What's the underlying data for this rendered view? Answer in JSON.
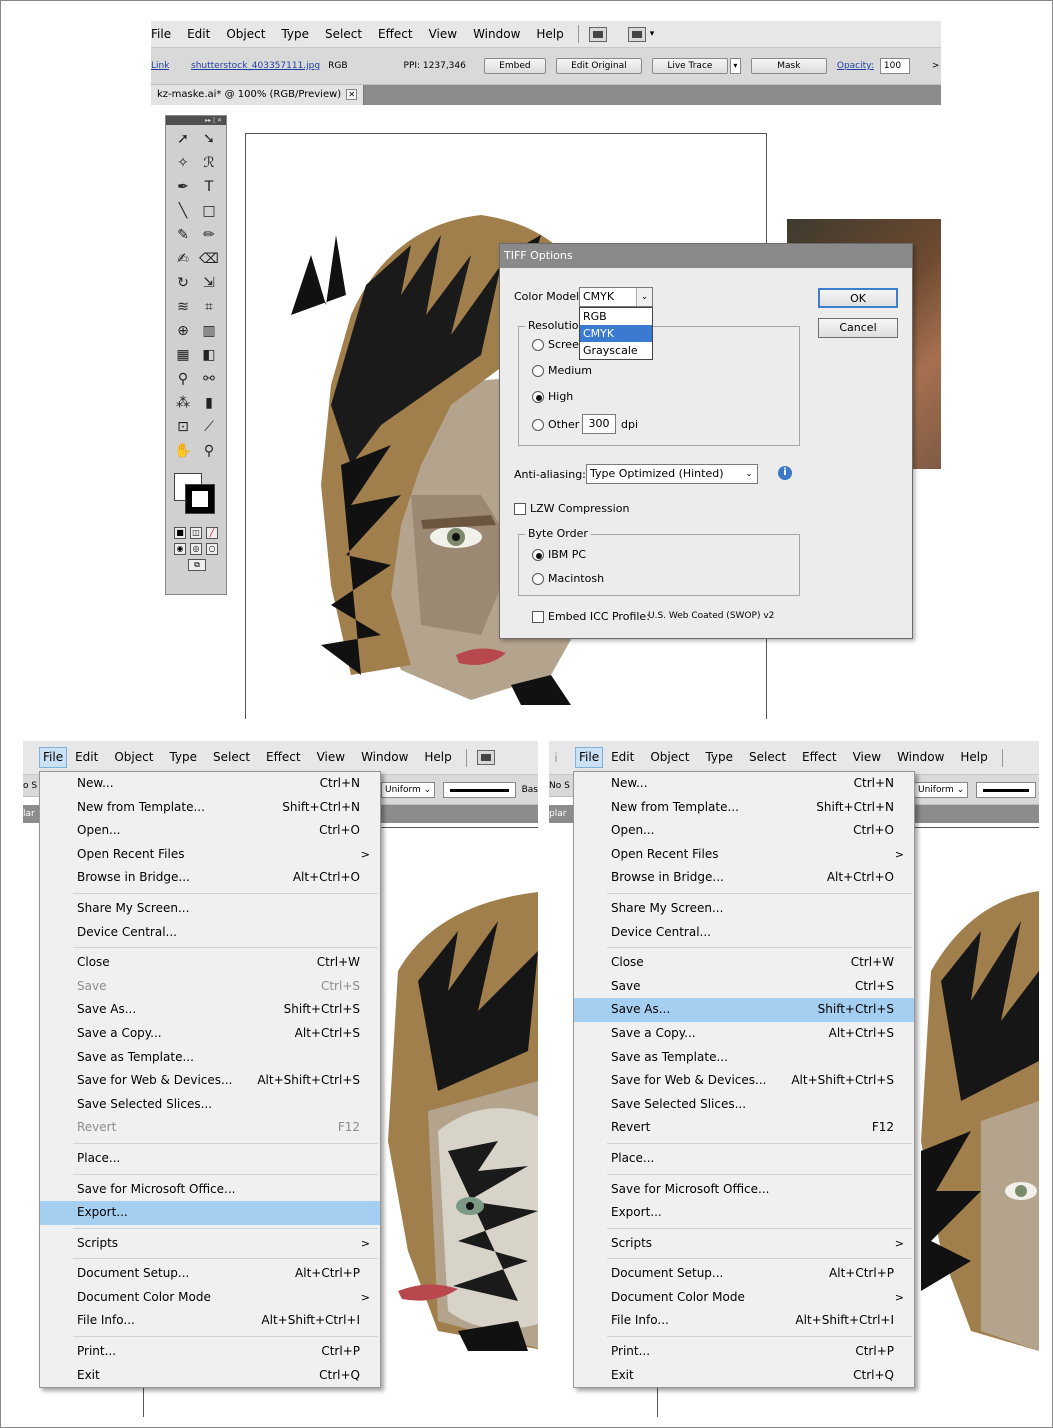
{
  "menubar": {
    "items": [
      "File",
      "Edit",
      "Object",
      "Type",
      "Select",
      "Effect",
      "View",
      "Window",
      "Help"
    ]
  },
  "top": {
    "control_bar": {
      "linked_file_label": "Linked File",
      "file_name": "shutterstock_403357111.jpg",
      "color_mode": "RGB",
      "ppi": "PPI: 1237,346",
      "embed": "Embed",
      "edit_original": "Edit Original",
      "live_trace": "Live Trace",
      "mask": "Mask",
      "opacity_label": "Opacity:",
      "opacity_value": "100",
      "more": ">"
    },
    "doc_tab": "kz-maske.ai* @ 100% (RGB/Preview)",
    "dialog": {
      "title": "TIFF Options",
      "color_model_label": "Color Model:",
      "color_model_value": "CMYK",
      "color_model_options": [
        "RGB",
        "CMYK",
        "Grayscale"
      ],
      "resolution_label": "Resolution",
      "res_screen": "Scree",
      "res_medium": "Medium",
      "res_high": "High",
      "res_other": "Other",
      "res_other_value": "300",
      "res_unit": "dpi",
      "anti_aliasing_label": "Anti-aliasing:",
      "anti_aliasing_value": "Type Optimized (Hinted)",
      "lzw_label": "LZW Compression",
      "byte_order_label": "Byte Order",
      "byte_ibm": "IBM PC",
      "byte_mac": "Macintosh",
      "icc_label": "Embed ICC Profile:",
      "icc_value": "U.S. Web Coated (SWOP) v2",
      "ok": "OK",
      "cancel": "Cancel"
    }
  },
  "left": {
    "control_bar": {
      "left_cut": "o S",
      "uniform": "Uniform",
      "basic_cut": "Bas",
      "tab_cut": "lar"
    },
    "menu": [
      {
        "label": "New...",
        "shortcut": "Ctrl+N"
      },
      {
        "label": "New from Template...",
        "shortcut": "Shift+Ctrl+N"
      },
      {
        "label": "Open...",
        "shortcut": "Ctrl+O"
      },
      {
        "label": "Open Recent Files",
        "shortcut": "",
        "submenu": ">"
      },
      {
        "label": "Browse in Bridge...",
        "shortcut": "Alt+Ctrl+O"
      },
      {
        "label": "Share My Screen...",
        "shortcut": ""
      },
      {
        "label": "Device Central...",
        "shortcut": ""
      },
      {
        "label": "Close",
        "shortcut": "Ctrl+W"
      },
      {
        "label": "Save",
        "shortcut": "Ctrl+S"
      },
      {
        "label": "Save As...",
        "shortcut": "Shift+Ctrl+S"
      },
      {
        "label": "Save a Copy...",
        "shortcut": "Alt+Ctrl+S"
      },
      {
        "label": "Save as Template...",
        "shortcut": ""
      },
      {
        "label": "Save for Web & Devices...",
        "shortcut": "Alt+Shift+Ctrl+S"
      },
      {
        "label": "Save Selected Slices...",
        "shortcut": ""
      },
      {
        "label": "Revert",
        "shortcut": "F12"
      },
      {
        "label": "Place...",
        "shortcut": ""
      },
      {
        "label": "Save for Microsoft Office...",
        "shortcut": ""
      },
      {
        "label": "Export...",
        "shortcut": ""
      },
      {
        "label": "Scripts",
        "shortcut": "",
        "submenu": ">"
      },
      {
        "label": "Document Setup...",
        "shortcut": "Alt+Ctrl+P"
      },
      {
        "label": "Document Color Mode",
        "shortcut": "",
        "submenu": ">"
      },
      {
        "label": "File Info...",
        "shortcut": "Alt+Shift+Ctrl+I"
      },
      {
        "label": "Print...",
        "shortcut": "Ctrl+P"
      },
      {
        "label": "Exit",
        "shortcut": "Ctrl+Q"
      }
    ]
  },
  "right": {
    "control_bar": {
      "left_cut": "No S",
      "uniform": "Uniform",
      "tab_cut": "plar"
    }
  },
  "colors": {
    "menu_highlight": "#a5cff0",
    "dropdown_highlight": "#3a7ad1",
    "hair_brown": "#9a7a4a",
    "skin": "#b5a48d",
    "lip": "#b8474e"
  }
}
